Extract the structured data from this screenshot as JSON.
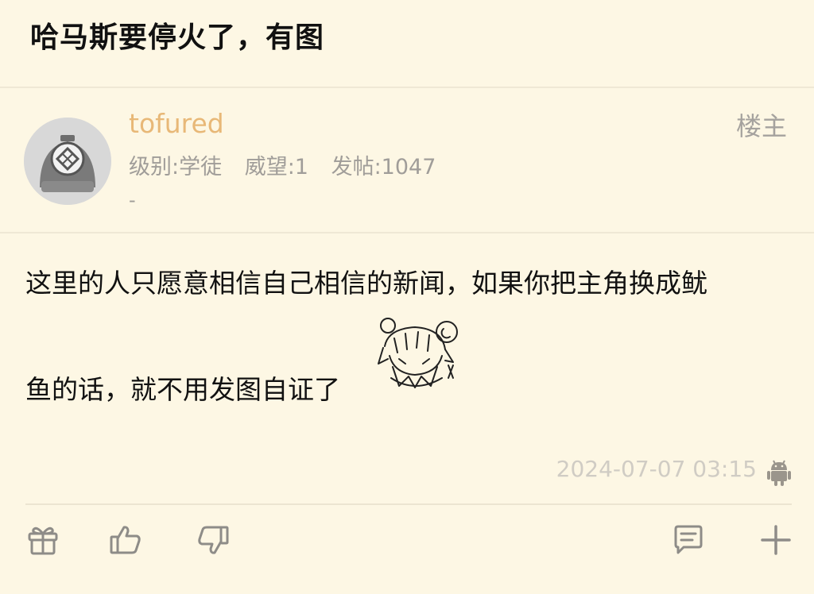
{
  "post": {
    "title": "哈马斯要停火了，有图"
  },
  "author": {
    "username": "tofured",
    "level": "级别:学徒",
    "prestige": "威望:1",
    "posts": "发帖:1047",
    "signature": "-",
    "role": "楼主"
  },
  "reply": {
    "line1": "这里的人只愿意相信自己相信的新闻，如果你把主角换成鱿",
    "line2": "鱼的话，就不用发图自证了",
    "timestamp": "2024-07-07 03:15",
    "device_icon": "android-icon"
  },
  "toolbar": {
    "icons": [
      "gift-icon",
      "thumbs-up-icon",
      "thumbs-down-icon",
      "comment-icon",
      "plus-icon"
    ]
  },
  "colors": {
    "background": "#FDF7E4",
    "username": "#E8B877",
    "meta_text": "#A09D99",
    "timestamp": "#D0CCC4",
    "icon": "#8E8C88"
  }
}
